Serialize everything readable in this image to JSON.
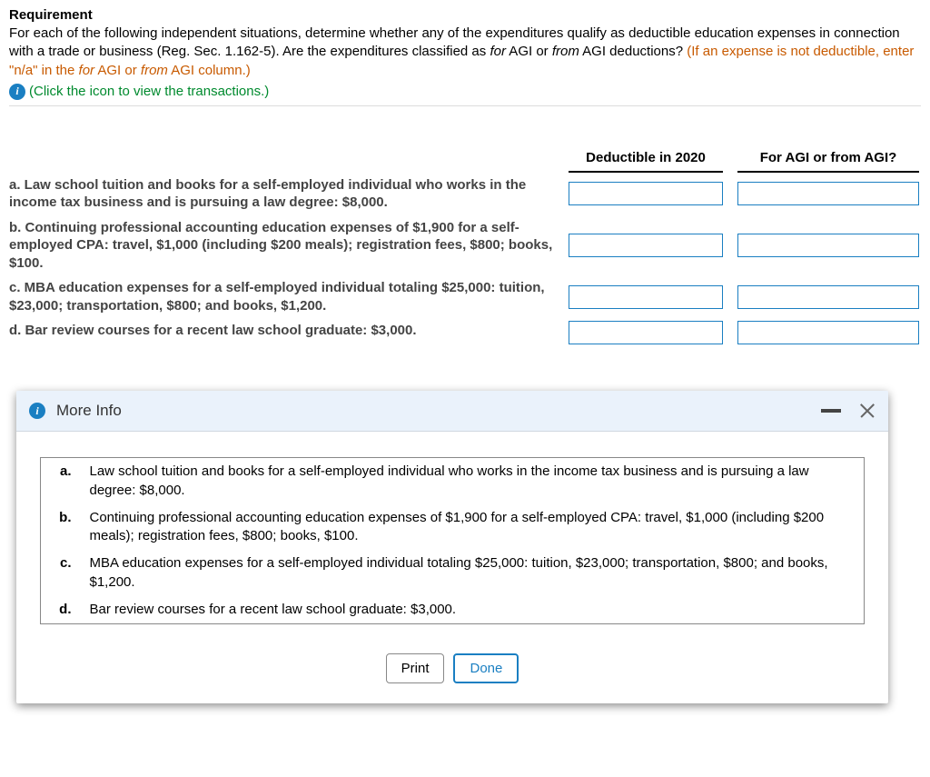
{
  "header": {
    "title": "Requirement",
    "body_part1": "For each of the following independent situations, determine whether any of the expenditures qualify as deductible education expenses in connection with a trade or business (Reg. Sec. 1.162-5). Are the expenditures classified as ",
    "body_italic1": "for",
    "body_mid1": " AGI or ",
    "body_italic2": "from",
    "body_part2": " AGI deductions? ",
    "warn1": "(If an expense is not deductible, enter \"n/a\" in the ",
    "warn_italic1": "for",
    "warn_mid": " AGI or ",
    "warn_italic2": "from",
    "warn2": " AGI column.)",
    "link": "(Click the icon to view the transactions.)"
  },
  "columns": {
    "deductible": "Deductible in 2020",
    "agi": "For AGI or from AGI?"
  },
  "questions": {
    "a": "a. Law school tuition and books for a self-employed individual who works in the income tax business and is pursuing a law degree: $8,000.",
    "b": "b. Continuing professional accounting education expenses of $1,900 for a self-employed CPA: travel, $1,000 (including $200 meals); registration fees, $800; books, $100.",
    "c": "c. MBA education expenses for a self-employed individual totaling $25,000: tuition, $23,000; transportation, $800; and books, $1,200.",
    "d": "d. Bar review courses for a recent law school graduate: $3,000."
  },
  "inputs": {
    "a_deductible": "",
    "a_agi": "",
    "b_deductible": "",
    "b_agi": "",
    "c_deductible": "",
    "c_agi": "",
    "d_deductible": "",
    "d_agi": ""
  },
  "modal": {
    "title": "More Info",
    "items": {
      "a_label": "a.",
      "a": "Law school tuition and books for a self-employed individual who works in the income tax business and is pursuing a law degree: $8,000.",
      "b_label": "b.",
      "b": "Continuing professional accounting education expenses of $1,900 for a self-employed CPA: travel, $1,000 (including $200 meals); registration fees, $800; books, $100.",
      "c_label": "c.",
      "c": "MBA education expenses for a self-employed individual totaling $25,000: tuition, $23,000; transportation, $800; and books, $1,200.",
      "d_label": "d.",
      "d": "Bar review courses for a recent law school graduate: $3,000."
    },
    "print": "Print",
    "done": "Done"
  }
}
